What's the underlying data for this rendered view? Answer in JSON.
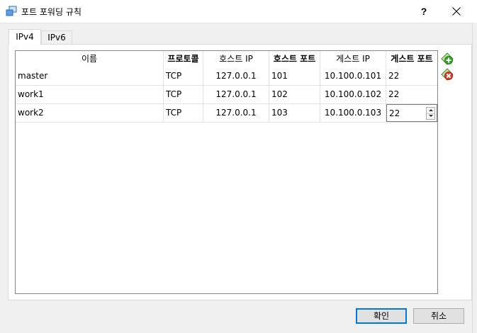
{
  "window": {
    "title": "포트 포워딩 규칙",
    "help_label": "?",
    "icon": "network-window-icon"
  },
  "tabs": [
    {
      "label": "IPv4",
      "selected": true
    },
    {
      "label": "IPv6",
      "selected": false
    }
  ],
  "table": {
    "headers": [
      "이름",
      "프로토콜",
      "호스트 IP",
      "호스트 포트",
      "게스트 IP",
      "게스트 포트"
    ],
    "rows": [
      [
        "master",
        "TCP",
        "127.0.0.1",
        "101",
        "10.100.0.101",
        "22"
      ],
      [
        "work1",
        "TCP",
        "127.0.0.1",
        "102",
        "10.100.0.102",
        "22"
      ],
      [
        "work2",
        "TCP",
        "127.0.0.1",
        "103",
        "10.100.0.103",
        "22"
      ]
    ]
  },
  "side_actions": {
    "add_icon": "add-rule-icon",
    "remove_icon": "remove-rule-icon",
    "add_color": "#3aa22e",
    "remove_color": "#d9402b"
  },
  "footer": {
    "ok_label": "확인",
    "cancel_label": "취소"
  },
  "colors": {
    "focus_border": "#0078d7",
    "grid_border": "#828790"
  }
}
